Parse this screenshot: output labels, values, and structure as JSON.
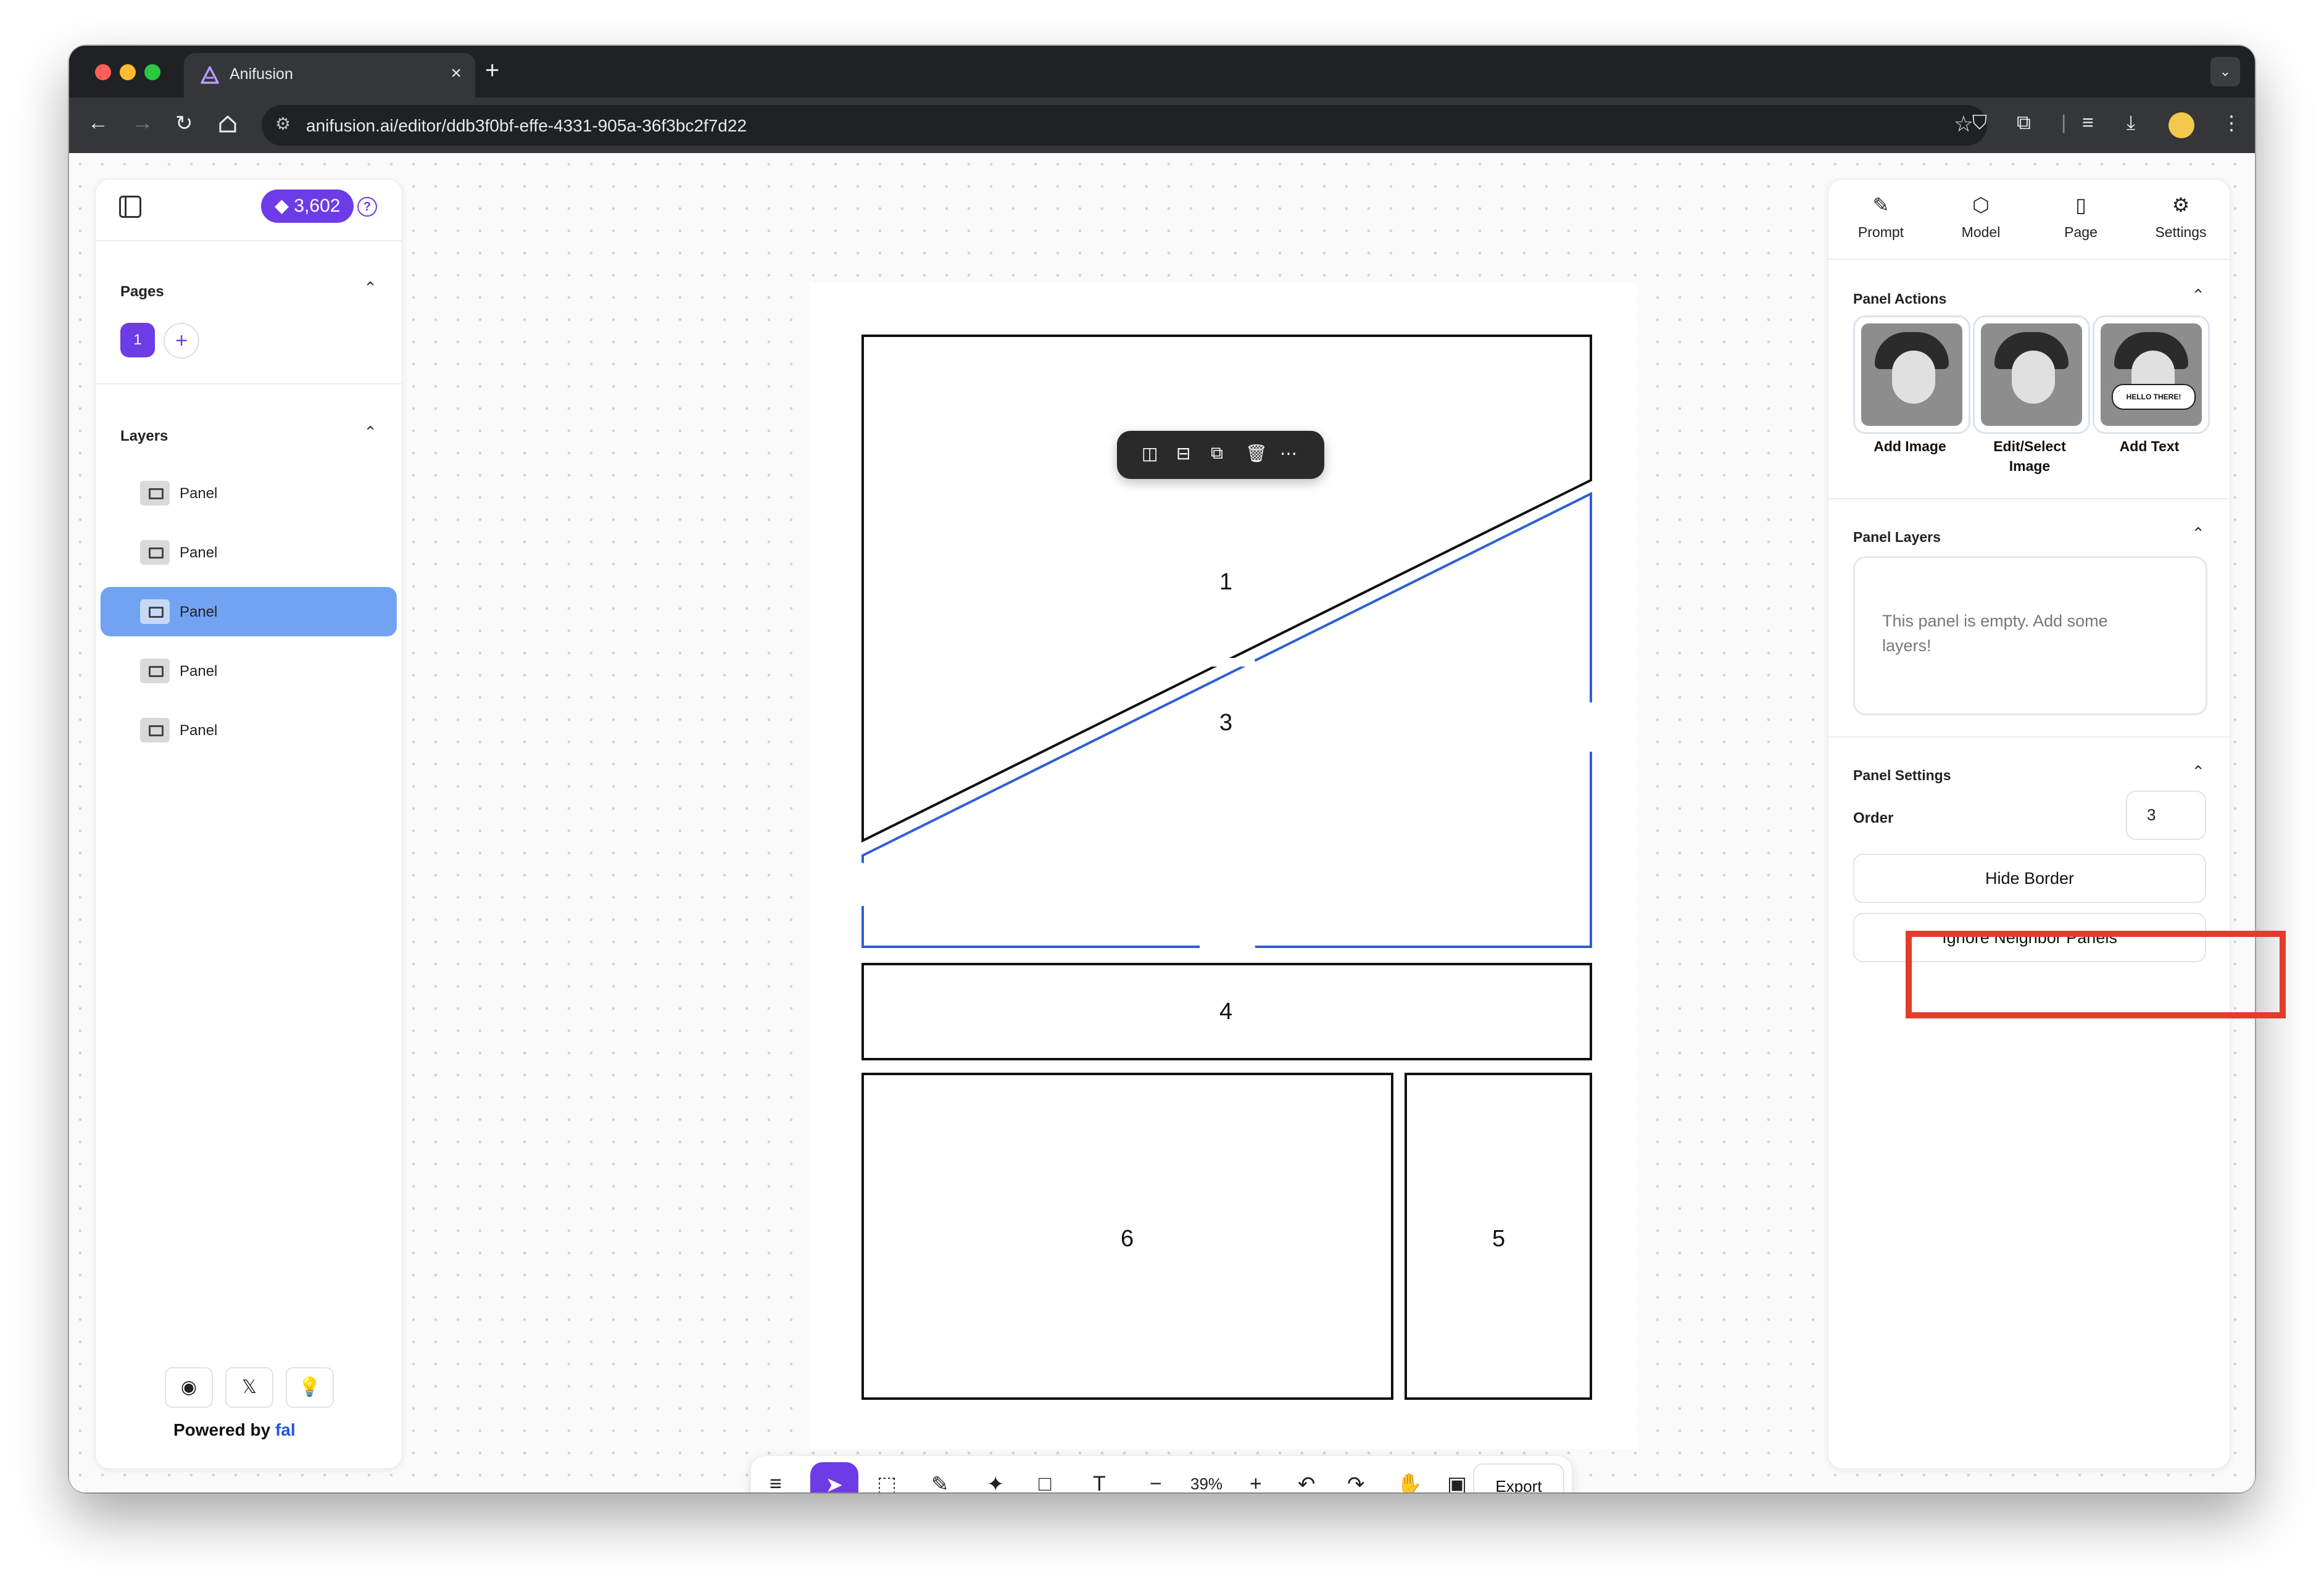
{
  "browser": {
    "tab_title": "Anifusion",
    "url": "anifusion.ai/editor/ddb3f0bf-effe-4331-905a-36f3bc2f7d22"
  },
  "left_panel": {
    "credits": "3,602",
    "pages_title": "Pages",
    "page_number": "1",
    "layers_title": "Layers",
    "layers": [
      {
        "label": "Panel",
        "selected": false
      },
      {
        "label": "Panel",
        "selected": false
      },
      {
        "label": "Panel",
        "selected": true
      },
      {
        "label": "Panel",
        "selected": false
      },
      {
        "label": "Panel",
        "selected": false
      }
    ],
    "powered_by": "Powered by",
    "brand": "fal"
  },
  "canvas": {
    "panels": [
      "1",
      "3",
      "4",
      "6",
      "5"
    ]
  },
  "bottom_toolbar": {
    "zoom": "39%",
    "export_label": "Export"
  },
  "right_panel": {
    "tabs": [
      {
        "label": "Prompt",
        "icon": "pencil-icon"
      },
      {
        "label": "Model",
        "icon": "cube-icon"
      },
      {
        "label": "Page",
        "icon": "page-icon"
      },
      {
        "label": "Settings",
        "icon": "gear-icon"
      }
    ],
    "panel_actions_title": "Panel Actions",
    "actions": [
      {
        "label": "Add Image"
      },
      {
        "label": "Edit/Select Image"
      },
      {
        "label": "Add Text",
        "bubble": "HELLO THERE!"
      }
    ],
    "panel_layers_title": "Panel Layers",
    "empty_message": "This panel is empty. Add some layers!",
    "panel_settings_title": "Panel Settings",
    "order_label": "Order",
    "order_value": "3",
    "hide_border_label": "Hide Border",
    "ignore_neighbor_label": "Ignore Neighbor Panels"
  },
  "colors": {
    "accent": "#6d3ce6",
    "selected_layer": "#72a2f2",
    "highlight": "#e53b2c"
  }
}
